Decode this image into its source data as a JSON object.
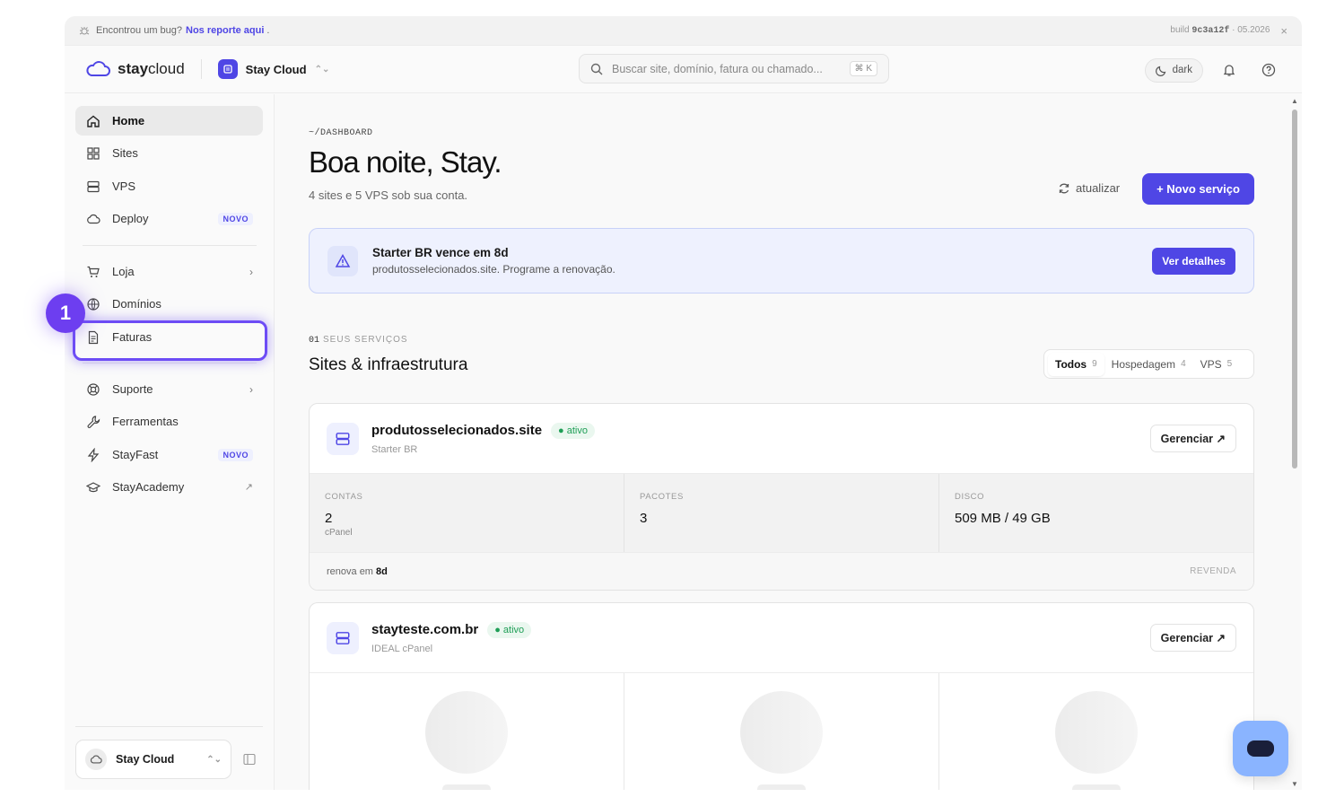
{
  "bugbar": {
    "text": "Encontrou um bug?",
    "link": "Nos reporte aqui",
    "after_link": ".",
    "build_label": "build",
    "build_hash": "9c3a12f",
    "build_date": "· 05.2026",
    "close": "×"
  },
  "topbar": {
    "logo_bold": "stay",
    "logo_rest": "cloud",
    "org_name": "Stay Cloud",
    "search_placeholder": "Buscar site, domínio, fatura ou chamado...",
    "search_shortcut": "⌘ K",
    "theme_label": "dark"
  },
  "sidebar": {
    "items": [
      {
        "label": "Home",
        "icon": "home-icon"
      },
      {
        "label": "Sites",
        "icon": "grid-icon"
      },
      {
        "label": "VPS",
        "icon": "server-icon"
      },
      {
        "label": "Deploy",
        "icon": "cloud-icon",
        "badge": "NOVO"
      },
      {
        "label": "Loja",
        "icon": "cart-icon"
      },
      {
        "label": "Domínios",
        "icon": "globe-icon"
      },
      {
        "label": "Faturas",
        "icon": "invoice-icon"
      },
      {
        "label": "Suporte",
        "icon": "lifebuoy-icon"
      },
      {
        "label": "Ferramentas",
        "icon": "wrench-icon"
      },
      {
        "label": "StayFast",
        "icon": "bolt-icon",
        "badge": "NOVO"
      },
      {
        "label": "StayAcademy",
        "icon": "graduation-cap-icon"
      }
    ],
    "org_switch_label": "Stay Cloud",
    "step_marker": "1"
  },
  "main": {
    "breadcrumb": "~/DASHBOARD",
    "greeting": "Boa noite, Stay.",
    "subtitle": "4 sites e 5 VPS sob sua conta.",
    "refresh_label": "atualizar",
    "new_service_label": "+ Novo serviço",
    "alert": {
      "title": "Starter BR vence em 8d",
      "text": "produtosselecionados.site. Programe a renovação.",
      "button": "Ver detalhes"
    },
    "section": {
      "num": "01",
      "kicker": "SEUS SERVIÇOS",
      "title": "Sites & infraestrutura"
    },
    "filters": [
      {
        "label": "Todos",
        "count": "9"
      },
      {
        "label": "Hospedagem",
        "count": "4"
      },
      {
        "label": "VPS",
        "count": "5"
      }
    ],
    "cards": [
      {
        "name": "produtosselecionados.site",
        "status": "ativo",
        "plan": "Starter BR",
        "manage": "Gerenciar ↗",
        "stats": [
          {
            "label": "CONTAS",
            "value": "2",
            "note": "cPanel"
          },
          {
            "label": "PACOTES",
            "value": "3",
            "note": ""
          },
          {
            "label": "DISCO",
            "value": "509 MB / 49 GB",
            "note": ""
          }
        ],
        "renew_text": "renova em",
        "renew_value": "8d",
        "tag": "REVENDA"
      },
      {
        "name": "stayteste.com.br",
        "status": "ativo",
        "plan": "IDEAL cPanel",
        "manage": "Gerenciar ↗"
      }
    ]
  },
  "colors": {
    "accent": "#4f46e5",
    "highlight": "#6d4cf5",
    "status_green": "#1e9e56",
    "chat": "#8ab4ff"
  }
}
